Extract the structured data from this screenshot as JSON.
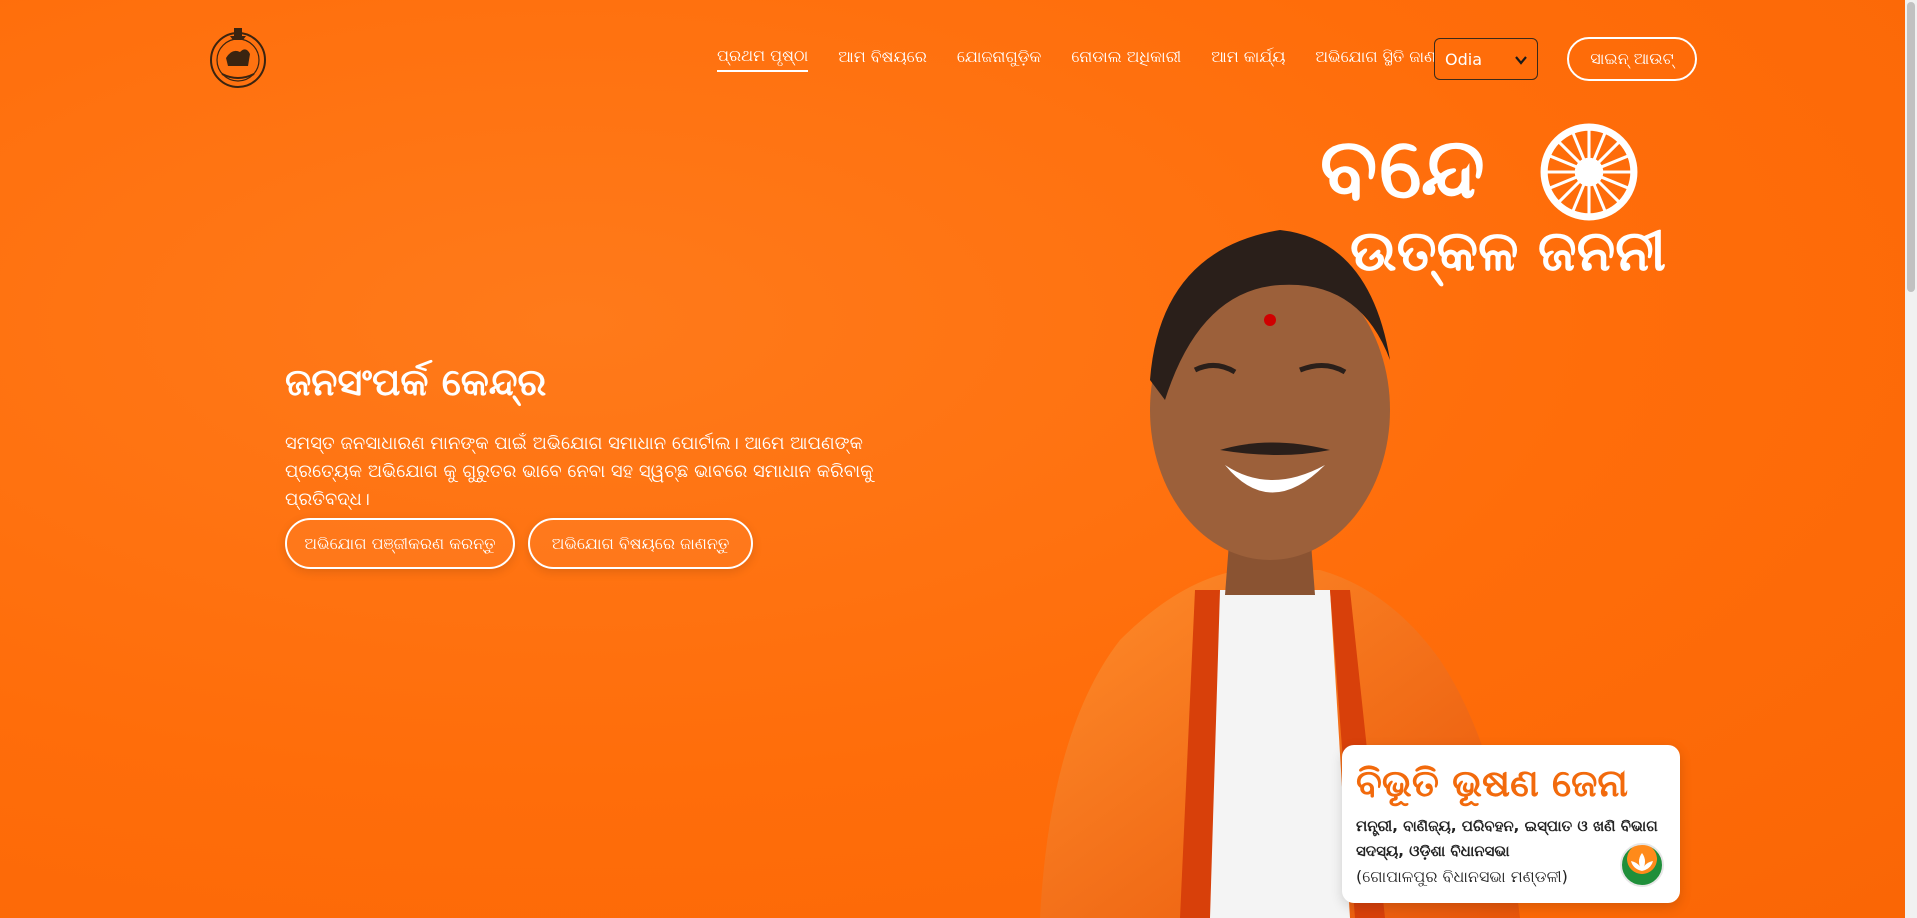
{
  "nav": {
    "items": [
      {
        "label": "ପ୍ରଥମ ପୃଷ୍ଠା",
        "active": true
      },
      {
        "label": "ଆମ ବିଷୟରେ",
        "active": false
      },
      {
        "label": "ଯୋଜନାଗୁଡ଼ିକ",
        "active": false
      },
      {
        "label": "ନୋଡାଲ ଅଧିକାରୀ",
        "active": false
      },
      {
        "label": "ଆମ କାର୍ଯ୍ୟ",
        "active": false
      },
      {
        "label": "ଅଭିଯୋଗ ସ୍ଥିତି ଜାଣନ୍ତୁ",
        "active": false
      }
    ],
    "language": "Odia",
    "signin_label": "ସାଇନ୍ ଆଉଟ୍"
  },
  "hero": {
    "title": "ଜନସଂପର୍କ କେନ୍ଦ୍ର",
    "description": "ସମସ୍ତ ଜନସାଧାରଣ ମାନଙ୍କ ପାଇଁ ଅଭିଯୋଗ ସମାଧାନ ପୋର୍ଟାଲ। ଆମେ ଆପଣଙ୍କ ପ୍ରତ୍ୟେକ ଅଭିଯୋଗ କୁ ଗୁରୁତର ଭାବେ ନେବା ସହ ସ୍ୱଚ୍ଛ ଭାବରେ ସମାଧାନ କରିବାକୁ ପ୍ରତିବଦ୍ଧ।",
    "register_button": "ଅଭିଯୋଗ ପଞ୍ଜୀକରଣ କରନ୍ତୁ",
    "about_button": "ଅଭିଯୋଗ ବିଷୟରେ ଜାଣନ୍ତୁ"
  },
  "slogan": {
    "line1": "ବନ୍ଦେ",
    "line2": "ଉତ୍କଳ ଜନନୀ"
  },
  "profile": {
    "name": "ବିଭୂତି ଭୂଷଣ ଜେନା",
    "role": "ମନ୍ତ୍ରୀ, ବାଣିଜ୍ୟ, ପରିବହନ, ଇସ୍ପାତ ଓ ଖଣି ବିଭାଗ",
    "member": "ସଦସ୍ୟ, ଓଡ଼ିଶା ବିଧାନସଭା",
    "constituency": "(ଗୋପାଳପୁର ବିଧାନସଭା ମଣ୍ଡଳୀ)",
    "party_logo_icon": "lotus-party-icon"
  },
  "colors": {
    "background": "#ff6d0a",
    "accent_text": "#f26a0c"
  }
}
